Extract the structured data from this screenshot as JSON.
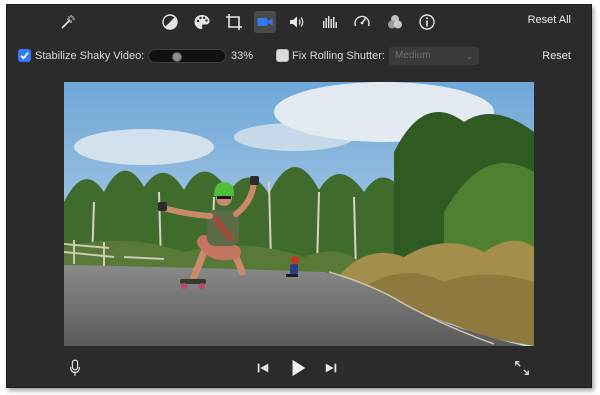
{
  "toolbar": {
    "icons": [
      "magic-wand-icon",
      "color-balance-icon",
      "color-correction-icon",
      "crop-icon",
      "stabilization-camera-icon",
      "volume-icon",
      "equalizer-icon",
      "speed-icon",
      "filter-icon",
      "info-icon"
    ],
    "active_tool": "stabilization-camera-icon",
    "reset_all_label": "Reset All"
  },
  "stabilize": {
    "label": "Stabilize Shaky Video:",
    "checked": true,
    "value_percent": 33,
    "value_label": "33%"
  },
  "rolling_shutter": {
    "label": "Fix Rolling Shutter:",
    "checked": false,
    "selected": "Medium"
  },
  "reset_label": "Reset",
  "playback": {
    "icons": [
      "microphone-icon",
      "skip-back-icon",
      "play-icon",
      "skip-forward-icon",
      "fullscreen-icon"
    ]
  },
  "colors": {
    "accent": "#2f7bf6",
    "window_bg": "#2b2b2b",
    "text": "#e9e9e9"
  }
}
